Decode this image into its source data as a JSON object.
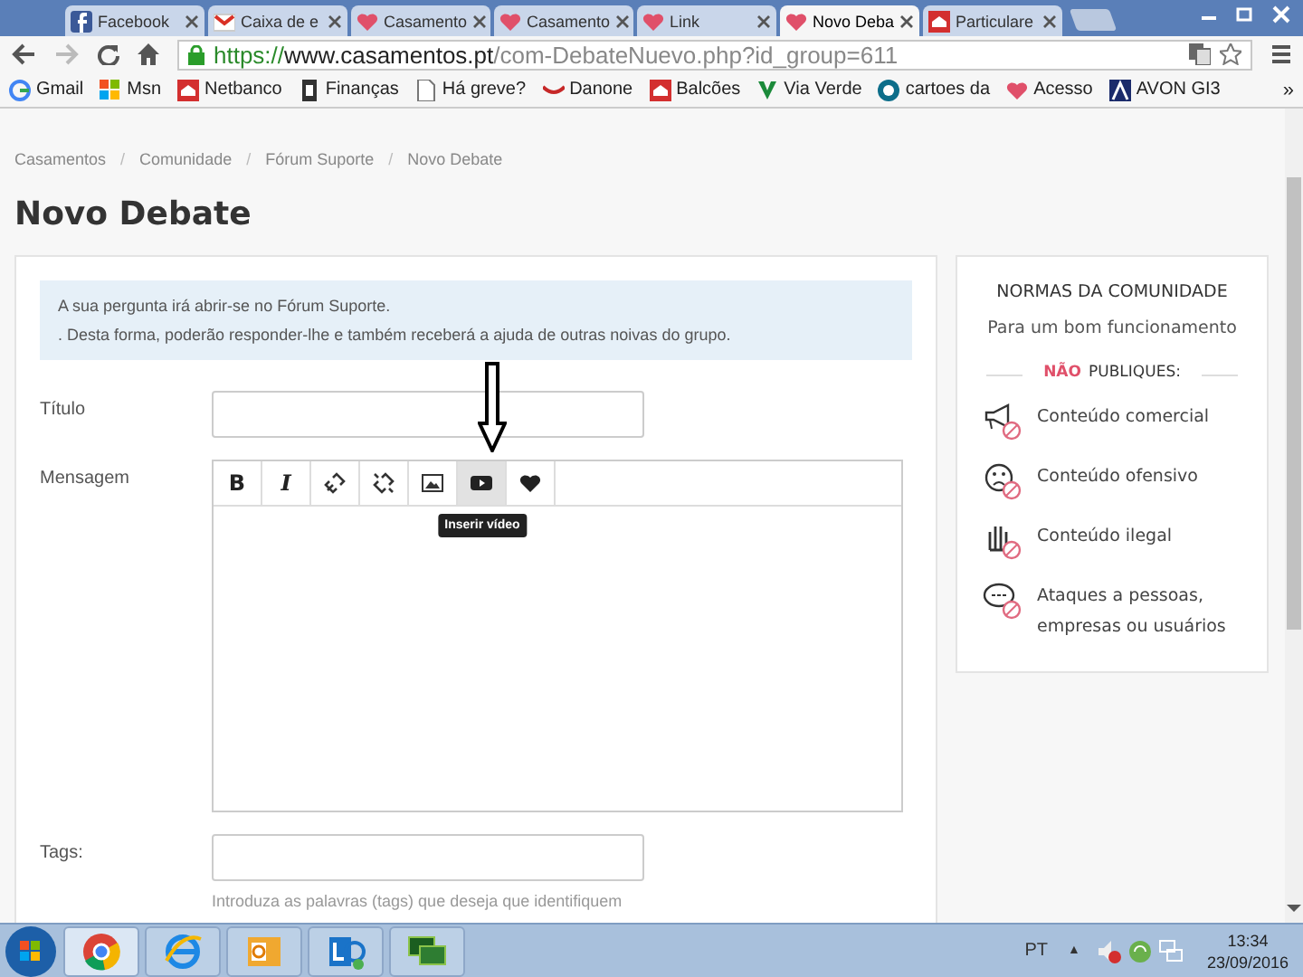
{
  "browser": {
    "tabs": [
      {
        "title": "Facebook",
        "kind": "facebook",
        "selected": false
      },
      {
        "title": "Caixa de e",
        "kind": "gmail",
        "selected": false
      },
      {
        "title": "Casamento",
        "kind": "heart",
        "selected": false
      },
      {
        "title": "Casamento",
        "kind": "heart",
        "selected": false
      },
      {
        "title": "Link",
        "kind": "heart",
        "selected": false
      },
      {
        "title": "Novo Deba",
        "kind": "heart",
        "selected": true
      },
      {
        "title": "Particulare",
        "kind": "bank",
        "selected": false
      }
    ],
    "address": {
      "scheme": "https://",
      "domain": "www.casamentos.pt",
      "path": "/com-DebateNuevo.php?id_group=611"
    },
    "bookmarks": [
      {
        "label": "Gmail",
        "kind": "g"
      },
      {
        "label": "Msn",
        "kind": "windows"
      },
      {
        "label": "Netbanco",
        "kind": "bank"
      },
      {
        "label": "Finanças",
        "kind": "doc-dark"
      },
      {
        "label": "Há greve?",
        "kind": "page"
      },
      {
        "label": "Danone",
        "kind": "smile"
      },
      {
        "label": "Balcões",
        "kind": "bank"
      },
      {
        "label": "Via Verde",
        "kind": "v"
      },
      {
        "label": "cartoes da",
        "kind": "circle"
      },
      {
        "label": "Acesso",
        "kind": "heart"
      },
      {
        "label": "AVON GI3",
        "kind": "a"
      }
    ],
    "bookmarks_more": "»"
  },
  "breadcrumb": {
    "separator": "/",
    "items": [
      "Casamentos",
      "Comunidade",
      "Fórum Suporte",
      "Novo Debate"
    ]
  },
  "title": "Novo Debate",
  "form": {
    "notice": [
      "A sua pergunta irá abrir-se no Fórum Suporte.",
      ". Desta forma, poderão responder-lhe e também receberá a ajuda de outras noivas do grupo."
    ],
    "title_label": "Título",
    "message_label": "Mensagem",
    "toolbar": [
      {
        "kind": "bold",
        "label": "B",
        "hovered": false
      },
      {
        "kind": "italic",
        "label": "I",
        "hovered": false
      },
      {
        "kind": "link",
        "hovered": false
      },
      {
        "kind": "unlink",
        "hovered": false
      },
      {
        "kind": "image",
        "hovered": false
      },
      {
        "kind": "video",
        "hovered": true
      },
      {
        "kind": "heart",
        "hovered": false
      }
    ],
    "tooltip": "Inserir vídeo",
    "tags_label": "Tags:",
    "tags_hint": "Introduza as palavras (tags) que deseja que identifiquem"
  },
  "rules": {
    "title": "NORMAS DA COMUNIDADE",
    "subtitle": "Para um bom funcionamento",
    "warning_word": "NÃO",
    "warning_rest": "PUBLIQUES:",
    "items": [
      {
        "kind": "megaphone",
        "text": "Conteúdo comercial"
      },
      {
        "kind": "sad-face",
        "text": "Conteúdo ofensivo"
      },
      {
        "kind": "hand",
        "text": "Conteúdo ilegal"
      },
      {
        "kind": "speech",
        "text": "Ataques a pessoas, empresas ou usuários"
      }
    ]
  },
  "taskbar": {
    "apps": [
      {
        "kind": "chrome",
        "selected": true
      },
      {
        "kind": "ie",
        "selected": false
      },
      {
        "kind": "outlook",
        "selected": false
      },
      {
        "kind": "lync",
        "selected": false
      },
      {
        "kind": "network",
        "selected": false
      }
    ],
    "language": "PT",
    "tray_caret": "▲",
    "time": "13:34",
    "date": "23/09/2016"
  }
}
